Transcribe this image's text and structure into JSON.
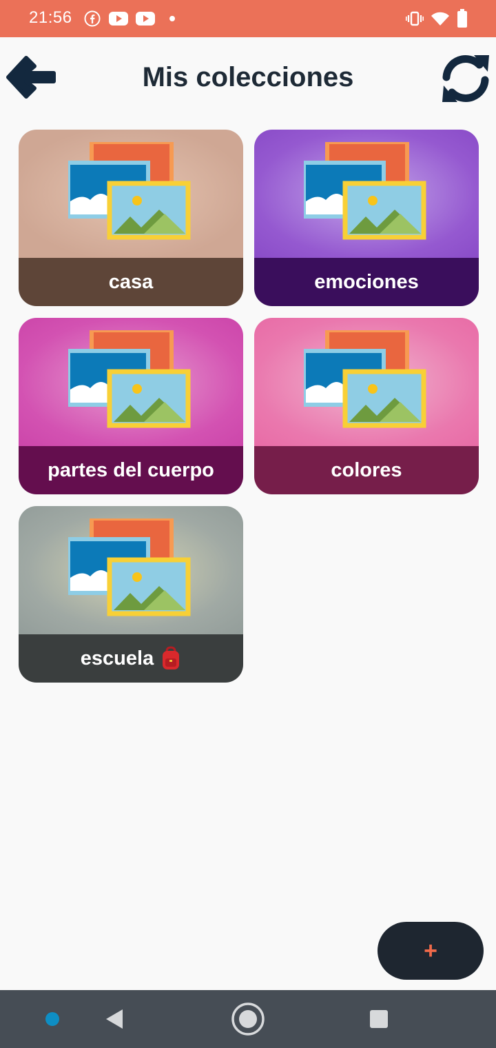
{
  "status_bar": {
    "time": "21:56",
    "notification_icons": [
      "facebook-icon",
      "youtube-icon",
      "youtube-icon",
      "dot-icon"
    ],
    "system_icons": [
      "vibrate-icon",
      "wifi-icon",
      "battery-icon"
    ],
    "background_color": "#eb7158"
  },
  "header": {
    "back_icon": "arrow-left-icon",
    "title": "Mis colecciones",
    "sync_icon": "sync-icon"
  },
  "collections": [
    {
      "label": "casa",
      "image_color": "#d3a896",
      "bar_color": "#5e4538"
    },
    {
      "label": "emociones",
      "image_color": "#9355cc",
      "bar_color": "#3a0e5c"
    },
    {
      "label": "partes del cuerpo",
      "image_color": "#d24fb0",
      "bar_color": "#640e4e"
    },
    {
      "label": "colores",
      "image_color": "#ea78ae",
      "bar_color": "#761e4a"
    },
    {
      "label": "escuela",
      "emoji": "🎒",
      "image_color": "#9aa49f",
      "bar_color": "#3a3e3e"
    }
  ],
  "fab": {
    "label": "+",
    "icon": "plus-icon"
  },
  "nav_bar": {
    "items": [
      "assistant-dot-icon",
      "back-triangle-icon",
      "home-circle-icon",
      "recents-square-icon"
    ]
  }
}
